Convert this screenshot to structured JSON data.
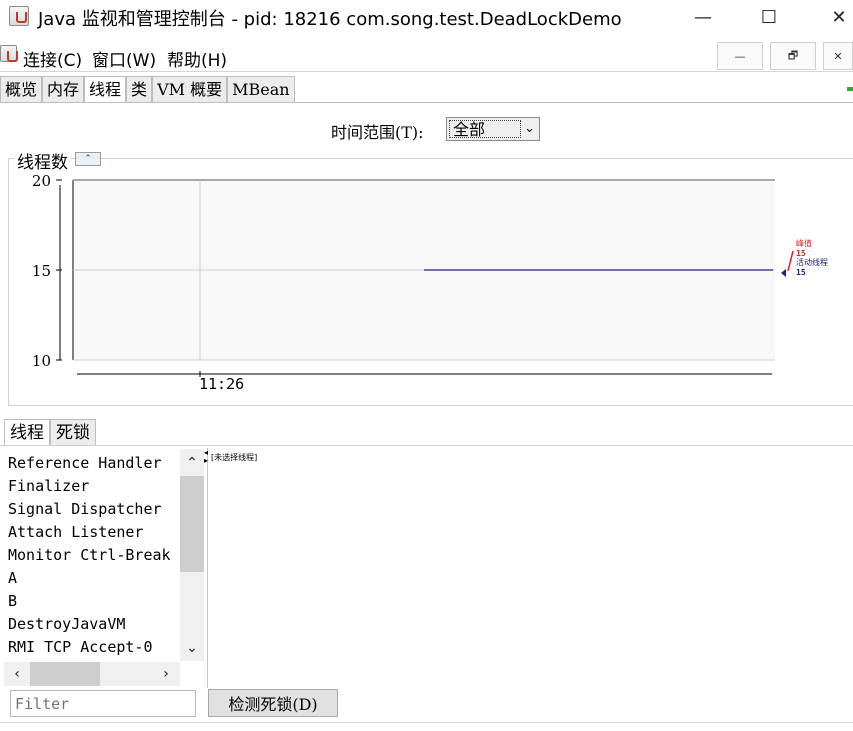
{
  "window": {
    "title": "Java 监视和管理控制台 - pid: 18216 com.song.test.DeadLockDemo",
    "minimize_glyph": "—",
    "maximize_glyph": "☐",
    "close_glyph": "✕"
  },
  "menu": {
    "items": [
      {
        "label": "连接(C)"
      },
      {
        "label": "窗口(W)"
      },
      {
        "label": "帮助(H)"
      }
    ],
    "mdi_minimize_glyph": "—",
    "mdi_restore_glyph": "🗗",
    "mdi_close_glyph": "✕"
  },
  "tabs": [
    {
      "label": "概览"
    },
    {
      "label": "内存"
    },
    {
      "label": "线程",
      "active": true
    },
    {
      "label": "类"
    },
    {
      "label": "VM 概要"
    },
    {
      "label": "MBean"
    }
  ],
  "time_range": {
    "label": "时间范围(T):",
    "value": "全部"
  },
  "thread_panel": {
    "title": "线程数",
    "collapse_glyph": "⌃"
  },
  "chart_data": {
    "type": "line",
    "title": "线程数",
    "ylim": [
      10,
      20
    ],
    "yticks": [
      "10",
      "15",
      "20"
    ],
    "xticks": [
      "11:26"
    ],
    "series": [
      {
        "name": "峰值",
        "color": "#e0201f",
        "value": 15
      },
      {
        "name": "活动线程",
        "color": "#1a237e",
        "value": 15,
        "line_start_fraction": 0.5,
        "line_end_fraction": 1.0
      }
    ],
    "legend": {
      "peak_label": "峰值",
      "peak_value": "15",
      "live_label": "活动线程",
      "live_value": "15"
    },
    "grid": true
  },
  "subtabs": [
    {
      "label": "线程",
      "active": true
    },
    {
      "label": "死锁"
    }
  ],
  "thread_list": {
    "items": [
      "Reference Handler",
      "Finalizer",
      "Signal Dispatcher",
      "Attach Listener",
      "Monitor Ctrl-Break",
      "A",
      "B",
      "DestroyJavaVM",
      "RMI TCP Accept-0"
    ]
  },
  "detail": {
    "text": "[未选择线程]"
  },
  "filter": {
    "placeholder": "Filter"
  },
  "detect_button": {
    "label": "检测死锁(D)"
  }
}
